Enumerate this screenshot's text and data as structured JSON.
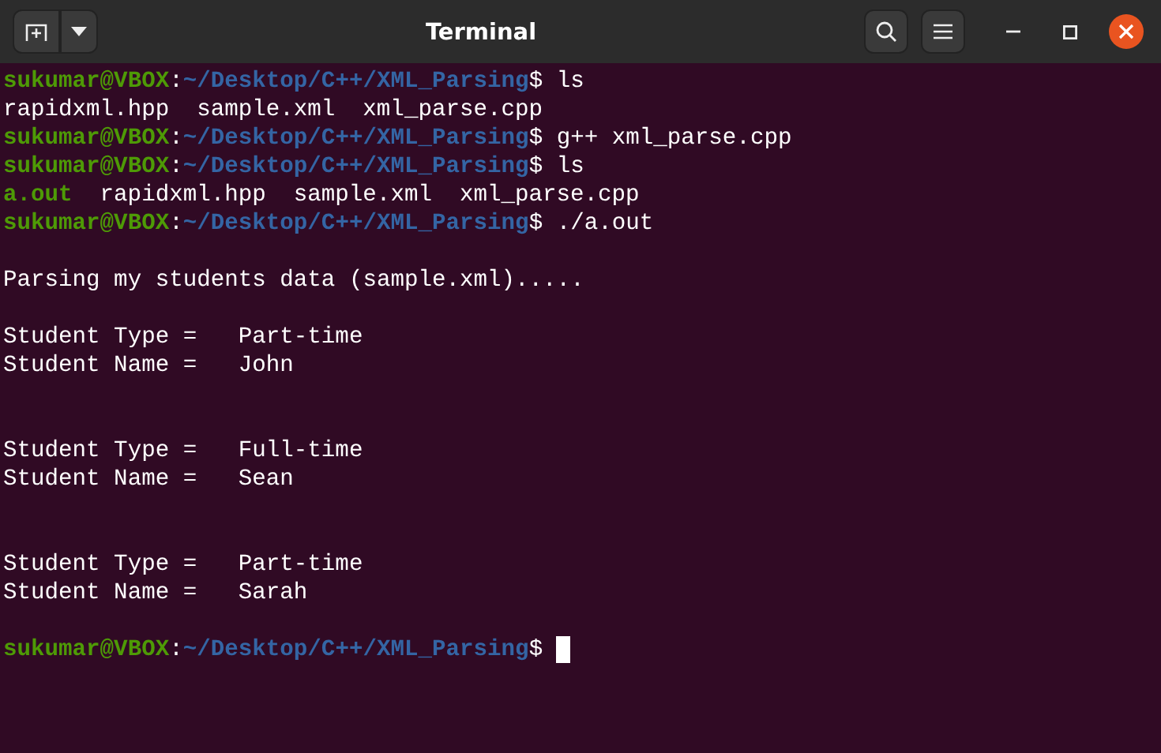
{
  "window": {
    "title": "Terminal"
  },
  "lines": [
    {
      "kind": "prompt",
      "user": "sukumar@VBOX",
      "sep": ":",
      "path": "~/Desktop/C++/XML_Parsing",
      "sign": "$",
      "command": "ls"
    },
    {
      "kind": "listing",
      "files": [
        {
          "name": "rapidxml.hpp",
          "kind": "file"
        },
        {
          "name": "sample.xml",
          "kind": "file"
        },
        {
          "name": "xml_parse.cpp",
          "kind": "file"
        }
      ]
    },
    {
      "kind": "prompt",
      "user": "sukumar@VBOX",
      "sep": ":",
      "path": "~/Desktop/C++/XML_Parsing",
      "sign": "$",
      "command": "g++ xml_parse.cpp"
    },
    {
      "kind": "prompt",
      "user": "sukumar@VBOX",
      "sep": ":",
      "path": "~/Desktop/C++/XML_Parsing",
      "sign": "$",
      "command": "ls"
    },
    {
      "kind": "listing",
      "files": [
        {
          "name": "a.out",
          "kind": "executable"
        },
        {
          "name": "rapidxml.hpp",
          "kind": "file"
        },
        {
          "name": "sample.xml",
          "kind": "file"
        },
        {
          "name": "xml_parse.cpp",
          "kind": "file"
        }
      ]
    },
    {
      "kind": "prompt",
      "user": "sukumar@VBOX",
      "sep": ":",
      "path": "~/Desktop/C++/XML_Parsing",
      "sign": "$",
      "command": "./a.out"
    },
    {
      "kind": "blank"
    },
    {
      "kind": "output",
      "text": "Parsing my students data (sample.xml)....."
    },
    {
      "kind": "blank"
    },
    {
      "kind": "output",
      "text": "Student Type =   Part-time"
    },
    {
      "kind": "output",
      "text": "Student Name =   John"
    },
    {
      "kind": "blank"
    },
    {
      "kind": "blank"
    },
    {
      "kind": "output",
      "text": "Student Type =   Full-time"
    },
    {
      "kind": "output",
      "text": "Student Name =   Sean"
    },
    {
      "kind": "blank"
    },
    {
      "kind": "blank"
    },
    {
      "kind": "output",
      "text": "Student Type =   Part-time"
    },
    {
      "kind": "output",
      "text": "Student Name =   Sarah"
    },
    {
      "kind": "blank"
    },
    {
      "kind": "prompt",
      "user": "sukumar@VBOX",
      "sep": ":",
      "path": "~/Desktop/C++/XML_Parsing",
      "sign": "$",
      "cursor": true
    }
  ]
}
